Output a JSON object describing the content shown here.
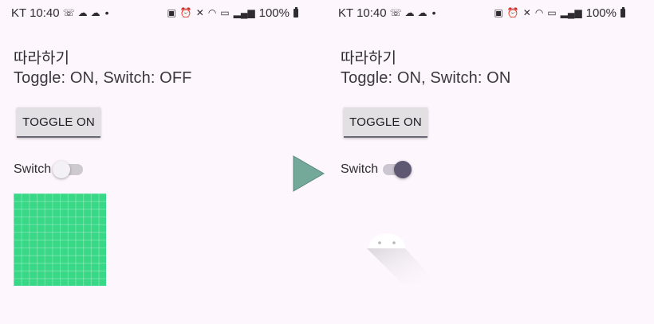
{
  "left": {
    "status": {
      "carrier_time": "KT 10:40",
      "battery": "100%"
    },
    "title": "따라하기",
    "state_text": "Toggle: ON, Switch: OFF",
    "toggle_button": "TOGGLE ON",
    "switch": {
      "label": "Switch",
      "checked": false
    }
  },
  "right": {
    "status": {
      "carrier_time": "KT 10:40",
      "battery": "100%"
    },
    "title": "따라하기",
    "state_text": "Toggle: ON, Switch: ON",
    "toggle_button": "TOGGLE ON",
    "switch": {
      "label": "Switch",
      "checked": true
    }
  },
  "colors": {
    "background": "#fdf6fd",
    "grid_image": "#39d887",
    "arrow": "#74a898",
    "switch_on_thumb": "#5e5873"
  },
  "icons": {
    "arrow": "play-arrow-icon",
    "placeholder": "android-icon"
  }
}
